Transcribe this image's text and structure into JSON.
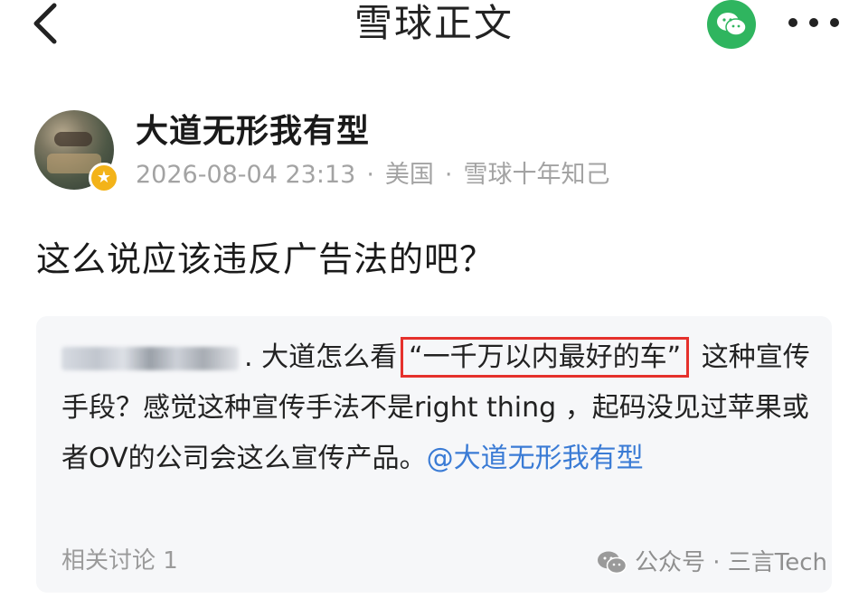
{
  "header": {
    "title": "雪球正文",
    "back_icon": "chevron-left-icon",
    "share_icon": "wechat-icon",
    "more_icon": "more-horizontal-icon",
    "share_color": "#2fb55f"
  },
  "post": {
    "author_name": "大道无形我有型",
    "timestamp": "2026-08-04 23:13",
    "location": "美国",
    "author_tag": "雪球十年知己",
    "meta_separator": "·",
    "text": "这么说应该违反广告法的吧？"
  },
  "quote": {
    "user_suffix": ".",
    "text_before": "大道怎么看",
    "highlighted": "“一千万以内最好的车”",
    "text_after": " 这种宣传手段？感觉这种宣传手法不是right thing ，起码没见过苹果或者OV的公司会这么宣传产品。",
    "mention": "@大道无形我有型",
    "discussion": "相关讨论 1",
    "highlight_color": "#e5312c",
    "mention_color": "#3a7bd5"
  },
  "watermark": {
    "icon": "wechat-icon",
    "text": "公众号 · 三言Tech"
  }
}
